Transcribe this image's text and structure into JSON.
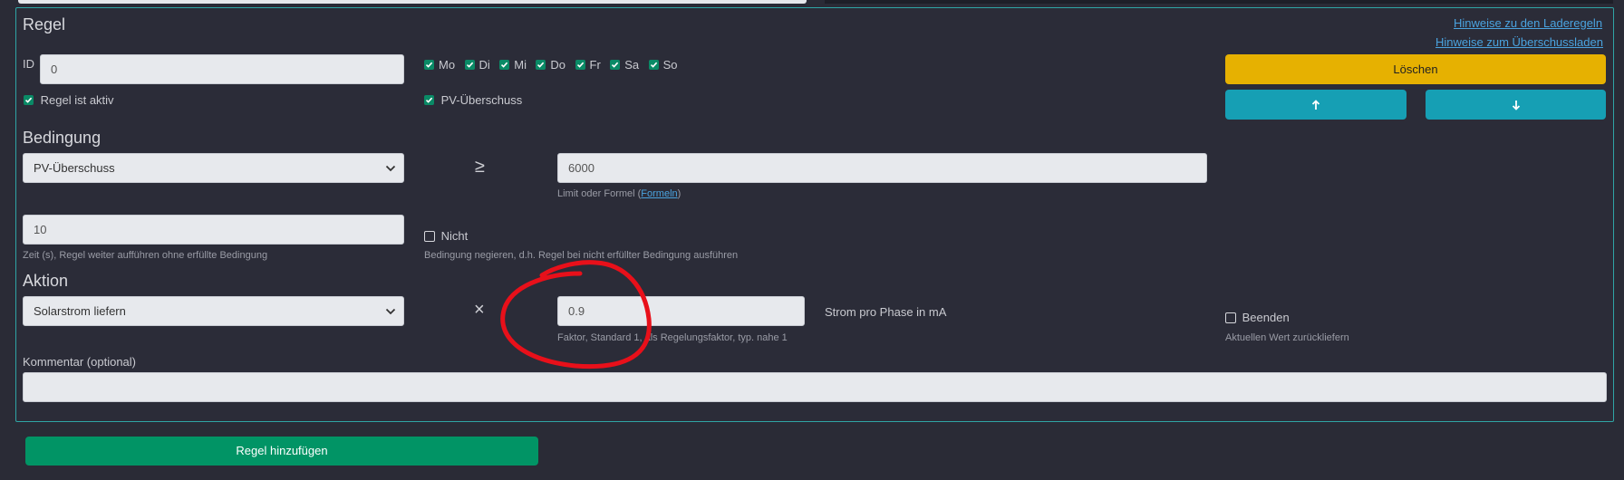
{
  "section_rule": {
    "title": "Regel",
    "id_label": "ID",
    "id_value": "0",
    "active_label": "Regel ist aktiv"
  },
  "links": {
    "laderegeln": "Hinweise zu den Laderegeln",
    "ueberschuss": "Hinweise zum Überschussladen"
  },
  "days": [
    "Mo",
    "Di",
    "Mi",
    "Do",
    "Fr",
    "Sa",
    "So"
  ],
  "pv_surplus_label": "PV-Überschuss",
  "buttons": {
    "delete": "Löschen",
    "up_icon": "arrow-up-icon",
    "down_icon": "arrow-down-icon",
    "add_rule": "Regel hinzufügen"
  },
  "condition": {
    "title": "Bedingung",
    "select_value": "PV-Überschuss",
    "operator": "≥",
    "limit_value": "6000",
    "limit_help_prefix": "Limit oder Formel (",
    "limit_help_link": "Formeln",
    "limit_help_suffix": ")",
    "time_value": "10",
    "time_help": "Zeit (s), Regel weiter aufführen ohne erfüllte Bedingung",
    "negate_label": "Nicht",
    "negate_help": "Bedingung negieren, d.h. Regel bei nicht erfüllter Bedingung ausführen"
  },
  "action": {
    "title": "Aktion",
    "select_value": "Solarstrom liefern",
    "operator": "×",
    "factor_value": "0.9",
    "factor_help": "Faktor, Standard 1, als Regelungsfaktor, typ. nahe 1",
    "unit_label": "Strom pro Phase in mA",
    "end_label": "Beenden",
    "end_help": "Aktuellen Wert zurückliefern"
  },
  "comment": {
    "label": "Kommentar (optional)",
    "value": ""
  },
  "colors": {
    "accent_border": "#2fa5a5",
    "checkbox": "#0a8a66",
    "delete": "#e6b101",
    "move": "#169fb4",
    "add": "#019465",
    "annotation": "#e8101a"
  }
}
